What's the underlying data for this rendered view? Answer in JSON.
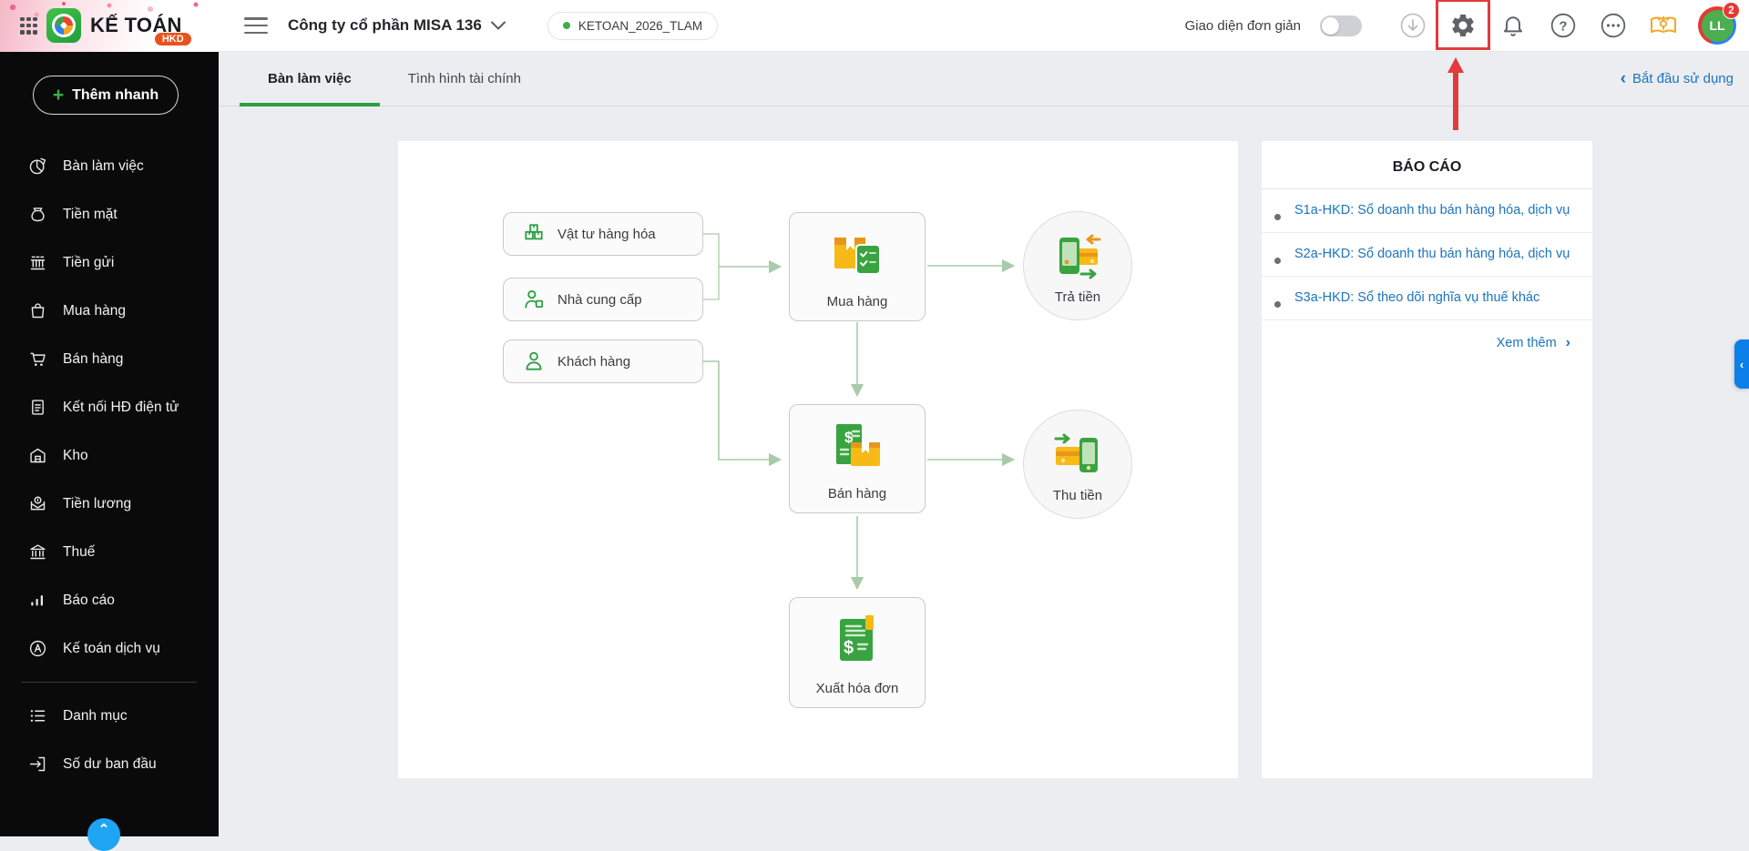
{
  "topbar": {
    "app_name": "KẾ TOÁN",
    "app_badge": "HKD",
    "company_name": "Công ty cổ phần MISA 136",
    "database_badge": "KETOAN_2026_TLAM",
    "simple_ui_label": "Giao diện đơn giản",
    "avatar_initials": "LL",
    "notification_count": "2",
    "help_glyph": "?"
  },
  "sidebar": {
    "quick_add_plus": "+",
    "quick_add_label": "Thêm nhanh",
    "items": [
      {
        "label": "Bàn làm việc"
      },
      {
        "label": "Tiền mặt"
      },
      {
        "label": "Tiền gửi"
      },
      {
        "label": "Mua hàng"
      },
      {
        "label": "Bán hàng"
      },
      {
        "label": "Kết nối HĐ điện tử"
      },
      {
        "label": "Kho"
      },
      {
        "label": "Tiền lương"
      },
      {
        "label": "Thuế"
      },
      {
        "label": "Báo cáo"
      },
      {
        "label": "Kế toán dịch vụ"
      },
      {
        "label": "Danh mục"
      },
      {
        "label": "Số dư ban đầu"
      }
    ]
  },
  "tabs": {
    "tab1": "Bàn làm việc",
    "tab2": "Tình hình tài chính"
  },
  "start_link": {
    "chevron": "‹",
    "label": "Bắt đầu sử dụng"
  },
  "flow": {
    "input_nodes": [
      {
        "label": "Vật tư hàng hóa"
      },
      {
        "label": "Nhà cung cấp"
      },
      {
        "label": "Khách hàng"
      }
    ],
    "process_nodes": [
      {
        "label": "Mua hàng"
      },
      {
        "label": "Bán hàng"
      },
      {
        "label": "Xuất hóa đơn"
      }
    ],
    "result_nodes": [
      {
        "label": "Trả tiền"
      },
      {
        "label": "Thu tiền"
      }
    ]
  },
  "reports": {
    "title": "BÁO CÁO",
    "items": [
      {
        "label": "S1a-HKD: Sổ doanh thu bán hàng hóa, dịch vụ"
      },
      {
        "label": "S2a-HKD: Sổ doanh thu bán hàng hóa, dịch vụ"
      },
      {
        "label": "S3a-HKD: Sổ theo dõi nghĩa vụ thuế khác"
      }
    ],
    "more_label": "Xem thêm",
    "more_chevron": "›"
  },
  "edge_tab_glyph": "‹",
  "chat_fab_glyph": "⌃",
  "colors": {
    "accent_green": "#2e9e44",
    "link_blue": "#1b74bc",
    "highlight_red": "#e23b3b",
    "sidebar_bg": "#0a0a0a",
    "content_bg": "#ecedf1",
    "badge_orange": "#e8521f",
    "toggle_off_gray": "#cfd0d5",
    "arrow_green": "#a9cba9"
  }
}
